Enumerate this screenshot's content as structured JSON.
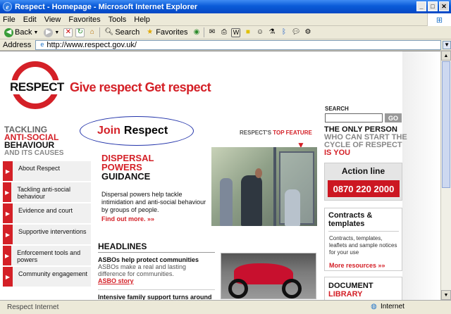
{
  "window": {
    "title": "Respect - Homepage - Microsoft Internet Explorer",
    "min": "_",
    "max": "□",
    "close": "✕"
  },
  "menu": {
    "items": [
      "File",
      "Edit",
      "View",
      "Favorites",
      "Tools",
      "Help"
    ]
  },
  "toolbar": {
    "back": "Back",
    "search": "Search",
    "favorites": "Favorites"
  },
  "address": {
    "label": "Address",
    "url": "http://www.respect.gov.uk/"
  },
  "status": {
    "zone": "Internet",
    "left_text": "Respect Internet"
  },
  "site": {
    "logo_word": "RESPECT",
    "tagline": {
      "a": "Give respect ",
      "b": "Get respect"
    },
    "search": {
      "label": "SEARCH",
      "go": "GO"
    },
    "left_heading": {
      "l1": "TACKLING",
      "l2": "ANTI-SOCIAL",
      "l3": "BEHAVIOUR",
      "l4": "AND ITS CAUSES"
    },
    "nav": [
      "About Respect",
      "Tackling anti-social behaviour",
      "Evidence and court",
      "Supportive interventions",
      "Enforcement tools and powers",
      "Community engagement"
    ],
    "join": {
      "a": "Join",
      "b": "Respect"
    },
    "feature": {
      "a": "RESPECT'S ",
      "b": "TOP FEATURE"
    },
    "dispersal": {
      "l1": "DISPERSAL",
      "l2": "POWERS",
      "l3": "GUIDANCE"
    },
    "dispersal_text": "Dispersal powers help tackle intimidation and anti-social behaviour by groups of people.",
    "find_out": "Find out more. »»",
    "headlines": {
      "title": "HEADLINES",
      "item1_title": "ASBOs help protect communities",
      "item1_text": "ASBOs make a real and lasting difference for communities.",
      "item1_link": "ASBO story",
      "item2_title": "Intensive family support turns around"
    },
    "only_person": {
      "l1": "THE ONLY PERSON",
      "l2": "WHO CAN START THE",
      "l3": "CYCLE OF RESPECT",
      "l4": "IS YOU"
    },
    "action_line": {
      "title": "Action line",
      "number": "0870 220 2000"
    },
    "contracts": {
      "title": "Contracts & templates",
      "desc": "Contracts, templates, leaflets and sample notices for your use",
      "more": "More resources »»"
    },
    "document_library": {
      "a": "DOCUMENT",
      "b": "LIBRARY"
    }
  }
}
